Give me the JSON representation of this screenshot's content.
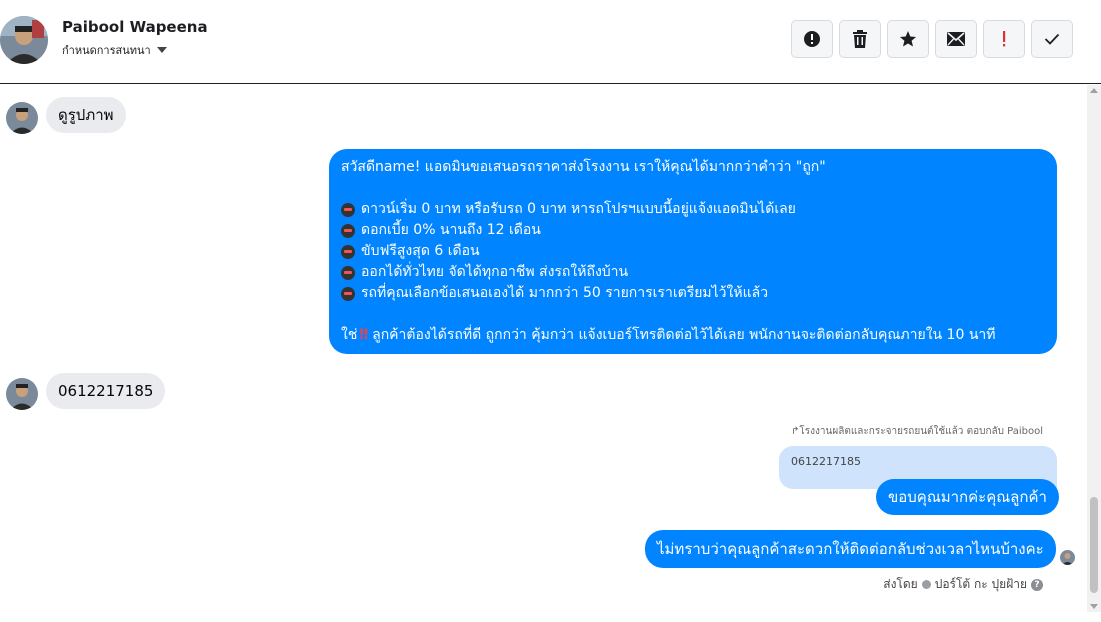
{
  "header": {
    "contact_name": "Paibool Wapeena",
    "manage_label": "กำหนดการสนทนา",
    "actions": [
      {
        "icon": "alert-circle-icon",
        "symbol": "!"
      },
      {
        "icon": "trash-icon",
        "symbol": "🗑"
      },
      {
        "icon": "star-icon",
        "symbol": "★"
      },
      {
        "icon": "envelope-icon",
        "symbol": "✉"
      },
      {
        "icon": "exclamation-icon",
        "symbol": "!"
      },
      {
        "icon": "checkmark-icon",
        "symbol": "✓"
      }
    ]
  },
  "messages": {
    "m1": "ดูรูปภาพ",
    "m2": {
      "line1": "สวัสดีname! แอดมินขอเสนอรถราคาส่งโรงงาน เราให้คุณได้มากกว่าคำว่า \"ถูก\"",
      "b1": "ดาวน์เริ่ม 0 บาท หรือรับรถ 0 บาท หารถโปรฯแบบนี้อยู่แจ้งแอดมินได้เลย",
      "b2": "ดอกเบี้ย 0% นานถึง 12 เดือน",
      "b3": "ขับฟรีสูงสุด 6 เดือน",
      "b4": "ออกได้ทั่วไทย จัดได้ทุกอาชีพ ส่งรถให้ถึงบ้าน",
      "b5": "รถที่คุณเลือกข้อเสนอเองได้ มากกว่า 50 รายการเราเตรียมไว้ให้แล้ว",
      "closing_prefix": "ใช่",
      "closing_mark": "‼",
      "closing_rest": "ลูกค้าต้องได้รถที่ดี ถูกกว่า คุ้มกว่า แจ้งเบอร์โทรติดต่อไว้ได้เลย พนักงานจะติดต่อกลับคุณภายใน 10 นาที"
    },
    "m3": "0612217185",
    "reply_note": "โรงงานผลิตและกระจายรถยนต์ใช้แล้ว ตอบกลับ Paibool",
    "quoted": "0612217185",
    "m4": "ขอบคุณมากค่ะคุณลูกค้า",
    "m5": "ไม่ทราบว่าคุณลูกค้าสะดวกให้ติดต่อกลับช่วงเวลาไหนบ้างคะ",
    "sent_by_prefix": "ส่งโดย",
    "sent_by_name": "ปอร์โต้ กะ ปุยฝ้าย"
  },
  "colors": {
    "accent": "#0084ff",
    "incoming_bubble": "#e9ebee",
    "quoted_bubble": "#cfe3fc"
  }
}
